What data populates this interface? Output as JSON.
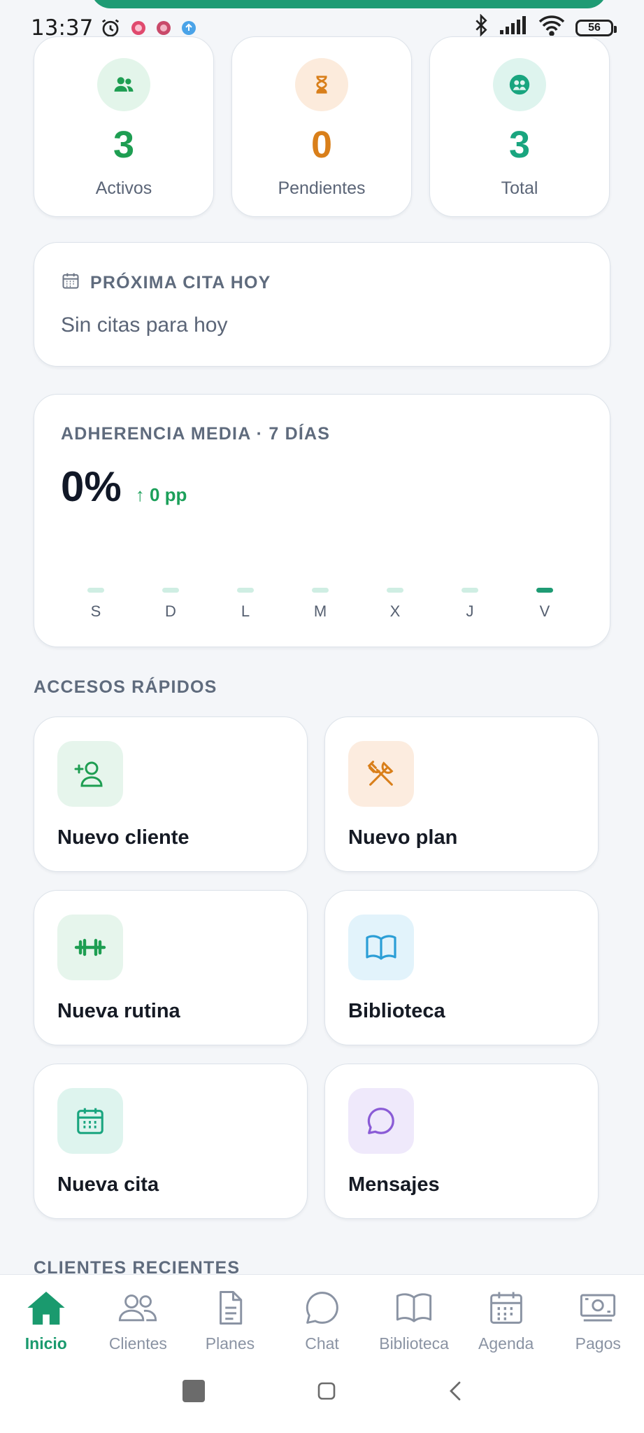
{
  "status_bar": {
    "time": "13:37",
    "battery": "56"
  },
  "stats": [
    {
      "value": "3",
      "label": "Activos",
      "color": "#1e9e52",
      "icon": "users-icon"
    },
    {
      "value": "0",
      "label": "Pendientes",
      "color": "#d97f1a",
      "icon": "hourglass-icon"
    },
    {
      "value": "3",
      "label": "Total",
      "color": "#19a57f",
      "icon": "user-group-icon"
    }
  ],
  "next_appointment": {
    "title": "PRÓXIMA CITA HOY",
    "subtitle": "Sin citas para hoy"
  },
  "adherence": {
    "title": "ADHERENCIA MEDIA · 7 DÍAS",
    "value": "0%",
    "delta": "↑ 0 pp",
    "days": [
      "S",
      "D",
      "L",
      "M",
      "X",
      "J",
      "V"
    ],
    "active_day": "V"
  },
  "quick_access": {
    "title": "ACCESOS RÁPIDOS",
    "items": [
      {
        "label": "Nuevo cliente",
        "icon": "add-user-icon"
      },
      {
        "label": "Nuevo plan",
        "icon": "utensils-icon"
      },
      {
        "label": "Nueva rutina",
        "icon": "dumbbell-icon"
      },
      {
        "label": "Biblioteca",
        "icon": "book-icon"
      },
      {
        "label": "Nueva cita",
        "icon": "calendar-icon"
      },
      {
        "label": "Mensajes",
        "icon": "chat-icon"
      }
    ]
  },
  "recent_clients": {
    "title": "CLIENTES RECIENTES"
  },
  "bottom_nav": {
    "items": [
      {
        "label": "Inicio",
        "icon": "home-icon",
        "active": true
      },
      {
        "label": "Clientes",
        "icon": "users-icon"
      },
      {
        "label": "Planes",
        "icon": "document-icon"
      },
      {
        "label": "Chat",
        "icon": "chat-icon"
      },
      {
        "label": "Biblioteca",
        "icon": "book-icon"
      },
      {
        "label": "Agenda",
        "icon": "calendar-icon"
      },
      {
        "label": "Pagos",
        "icon": "money-icon"
      }
    ]
  },
  "colors": {
    "accent": "#1f9b74",
    "active_green": "#1e9e52",
    "pending_orange": "#d97f1a"
  }
}
